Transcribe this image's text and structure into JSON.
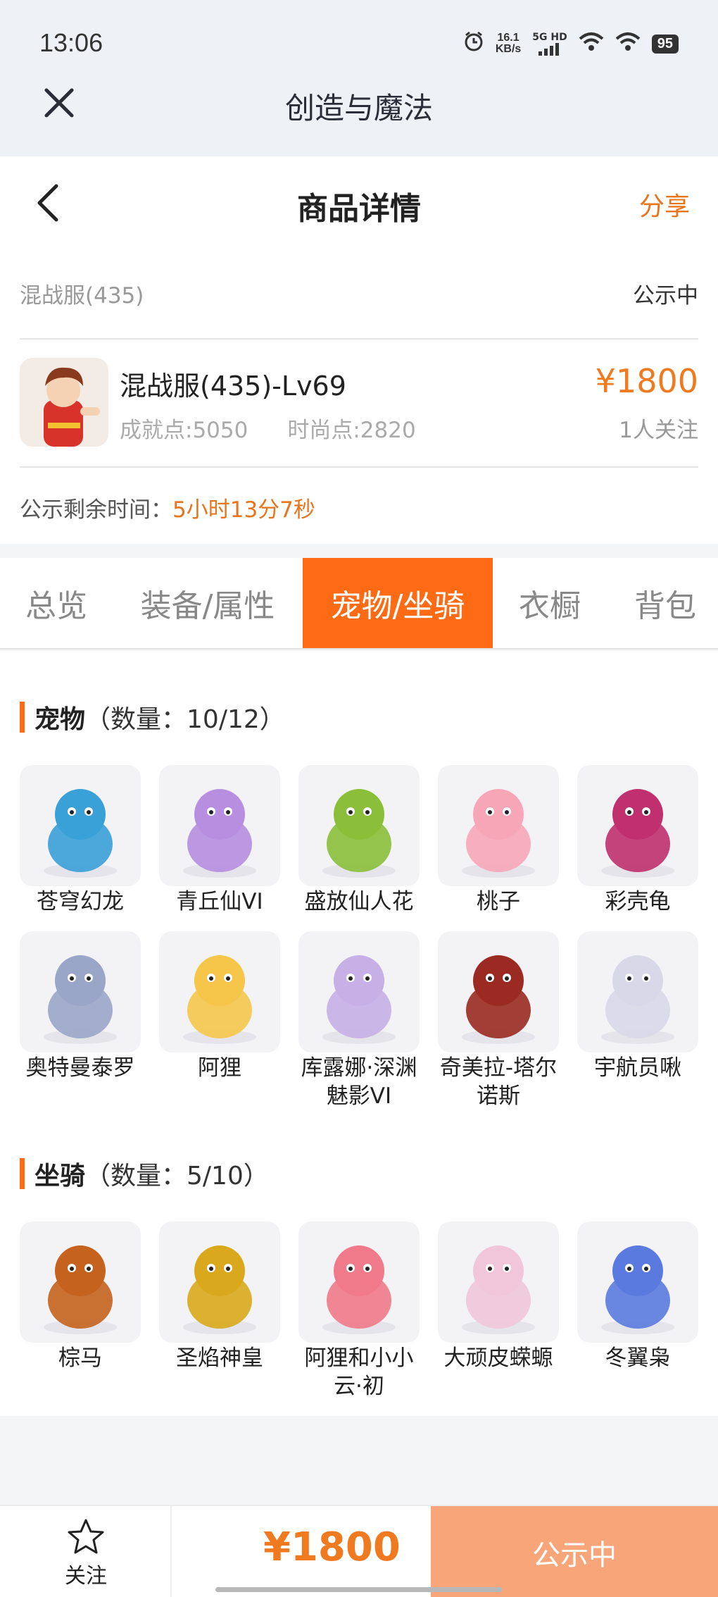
{
  "status_bar": {
    "time": "13:06",
    "speed_value": "16.1",
    "speed_unit": "KB/s",
    "network": "5G HD",
    "battery": "95"
  },
  "app": {
    "title": "创造与魔法"
  },
  "header": {
    "title": "商品详情",
    "share_label": "分享"
  },
  "product": {
    "server": "混战服(435)",
    "status": "公示中",
    "character_title": "混战服(435)-Lv69",
    "achievement": "成就点:5050",
    "fashion": "时尚点:2820",
    "price": "¥1800",
    "followers": "1人关注",
    "remaining_label": "公示剩余时间：",
    "remaining_value": "5小时13分7秒"
  },
  "tabs": [
    {
      "label": "总览",
      "active": false
    },
    {
      "label": "装备/属性",
      "active": false
    },
    {
      "label": "宠物/坐骑",
      "active": true
    },
    {
      "label": "衣橱",
      "active": false
    },
    {
      "label": "背包",
      "active": false
    }
  ],
  "pets": {
    "title": "宠物",
    "count": "（数量：10/12）",
    "items": [
      {
        "name": "苍穹幻龙",
        "icon": "dragon-icon",
        "color": "#3aa0d8"
      },
      {
        "name": "青丘仙VI",
        "icon": "fox-fairy-icon",
        "color": "#b78ee0"
      },
      {
        "name": "盛放仙人花",
        "icon": "cactus-flower-icon",
        "color": "#8bbf3a"
      },
      {
        "name": "桃子",
        "icon": "pink-bunny-icon",
        "color": "#f7a6b8"
      },
      {
        "name": "彩壳龟",
        "icon": "turtle-icon",
        "color": "#c0306e"
      },
      {
        "name": "奥特曼泰罗",
        "icon": "ultraman-icon",
        "color": "#9aa6c8"
      },
      {
        "name": "阿狸",
        "icon": "ali-fox-icon",
        "color": "#f5c64a"
      },
      {
        "name": "库露娜·深渊魅影VI",
        "icon": "abyss-phantom-icon",
        "color": "#c6b0e6"
      },
      {
        "name": "奇美拉-塔尔诺斯",
        "icon": "chimera-icon",
        "color": "#9a2a22"
      },
      {
        "name": "宇航员啾",
        "icon": "astronaut-icon",
        "color": "#d8d8e8"
      }
    ]
  },
  "mounts": {
    "title": "坐骑",
    "count": "（数量：5/10）",
    "items": [
      {
        "name": "棕马",
        "icon": "horse-icon",
        "color": "#c4621e"
      },
      {
        "name": "圣焰神皇",
        "icon": "golden-dragon-icon",
        "color": "#d9a81c"
      },
      {
        "name": "阿狸和小小云·初",
        "icon": "ali-cloud-icon",
        "color": "#f07a8a"
      },
      {
        "name": "大顽皮蝾螈",
        "icon": "salamander-icon",
        "color": "#f0c6d8"
      },
      {
        "name": "冬翼枭",
        "icon": "winter-owl-icon",
        "color": "#5a7adf"
      }
    ]
  },
  "bottom": {
    "follow_label": "关注",
    "price": "¥1800",
    "action_label": "公示中"
  },
  "colors": {
    "accent": "#ff6a14",
    "price": "#f07a20",
    "action_bg": "#f9a57a"
  }
}
